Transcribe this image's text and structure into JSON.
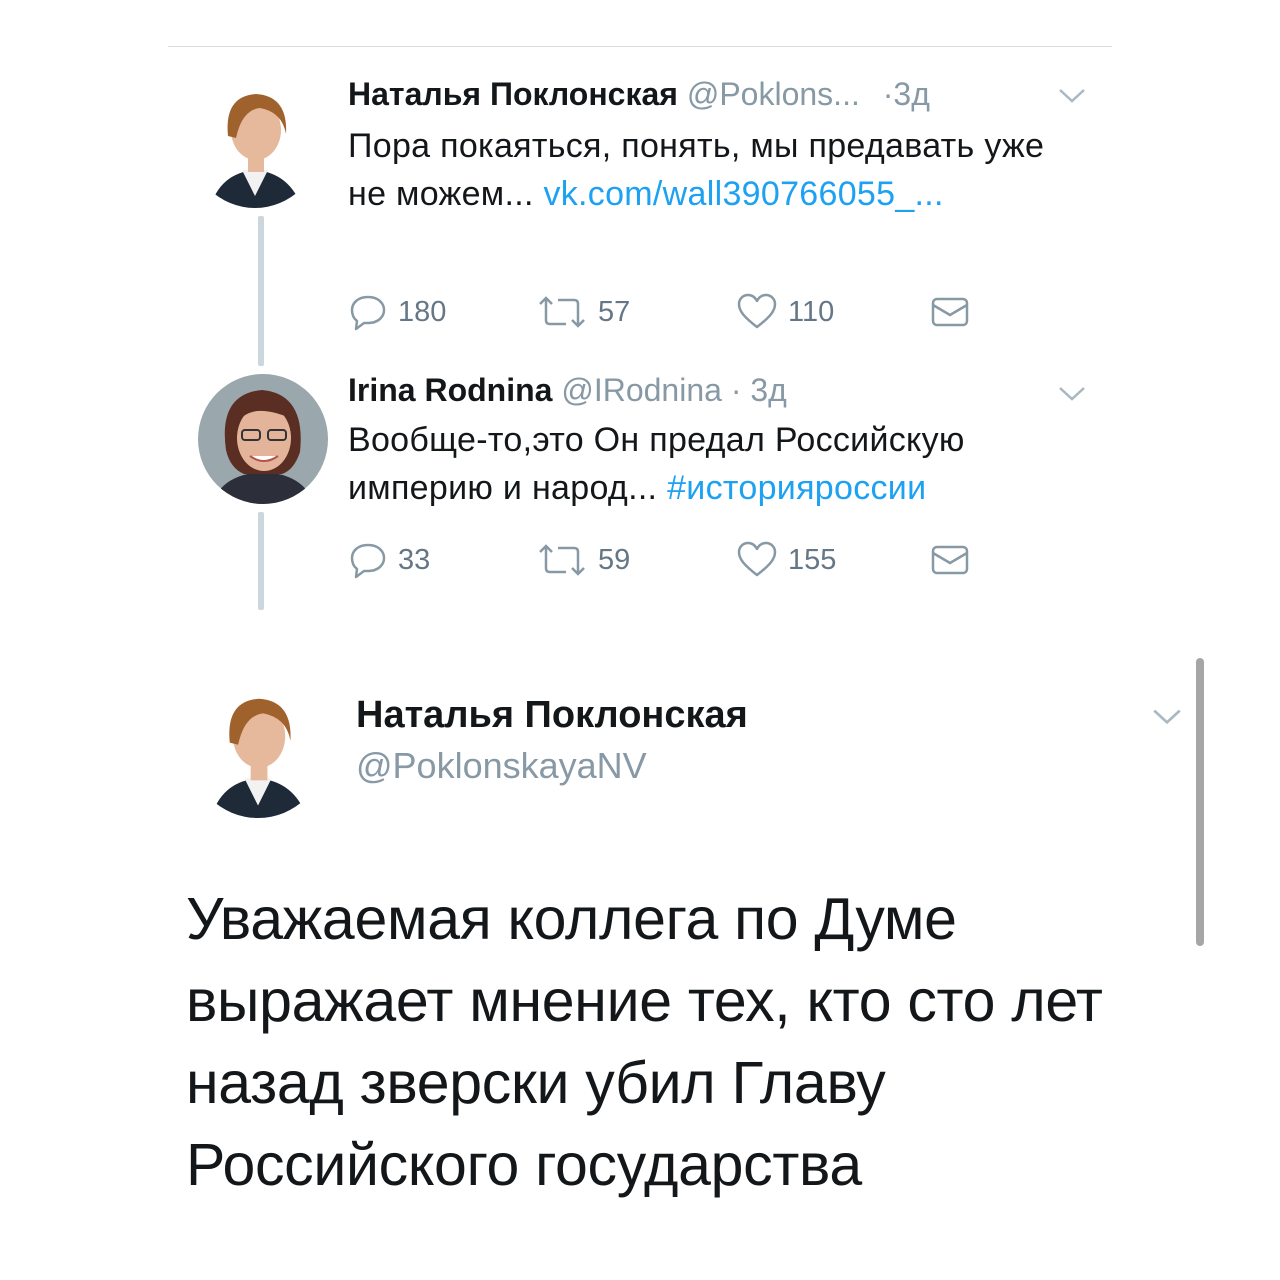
{
  "tweets": [
    {
      "name": "Наталья Поклонская",
      "handle": "@Poklons...",
      "dot": "·",
      "time": "3д",
      "text": "Пора покаяться, понять, мы предавать уже не можем... ",
      "link": "vk.com/wall390766055_...",
      "replies": "180",
      "retweets": "57",
      "likes": "110"
    },
    {
      "name": "Irina Rodnina",
      "handle": "@IRodnina",
      "dot": "·",
      "time": "3д",
      "text": "Вообще-то,это Он предал Российскую империю и народ... ",
      "link": "#историяроссии",
      "replies": "33",
      "retweets": "59",
      "likes": "155"
    }
  ],
  "main_tweet": {
    "name": "Наталья Поклонская",
    "handle": "@PoklonskayaNV",
    "text": "Уважаемая коллега по Думе выражает мнение тех, кто сто лет назад зверски убил Главу Российского государства"
  },
  "icons": {
    "reply": "reply-icon",
    "retweet": "retweet-icon",
    "like": "heart-icon",
    "dm": "envelope-icon",
    "menu": "chevron-down-icon"
  },
  "colors": {
    "link": "#1da1f2",
    "muted": "#8899a6",
    "text": "#14171a"
  }
}
